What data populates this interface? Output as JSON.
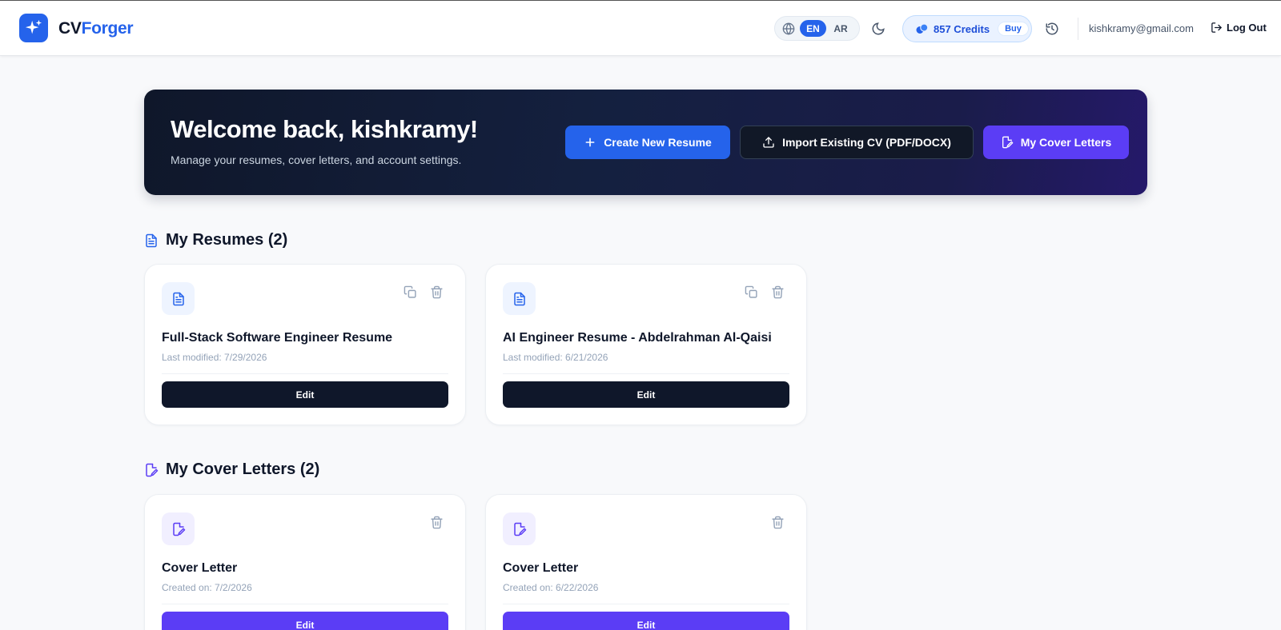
{
  "header": {
    "brand_prefix": "CV",
    "brand_suffix": "Forger",
    "lang_en": "EN",
    "lang_ar": "AR",
    "credits_label": "857 Credits",
    "buy_label": "Buy",
    "email": "kishkramy@gmail.com",
    "logout_label": "Log Out"
  },
  "hero": {
    "title": "Welcome back, kishkramy!",
    "subtitle": "Manage your resumes, cover letters, and account settings.",
    "create_label": "Create New Resume",
    "import_label": "Import Existing CV (PDF/DOCX)",
    "cover_label": "My Cover Letters"
  },
  "resumes": {
    "section_title": "My Resumes (2)",
    "items": [
      {
        "title": "Full-Stack Software Engineer Resume",
        "meta": "Last modified: 7/29/2026",
        "edit": "Edit"
      },
      {
        "title": "AI Engineer Resume - Abdelrahman Al-Qaisi",
        "meta": "Last modified: 6/21/2026",
        "edit": "Edit"
      }
    ]
  },
  "cover_letters": {
    "section_title": "My Cover Letters (2)",
    "items": [
      {
        "title": "Cover Letter",
        "meta": "Created on: 7/2/2026",
        "edit": "Edit"
      },
      {
        "title": "Cover Letter",
        "meta": "Created on: 6/22/2026",
        "edit": "Edit"
      }
    ]
  },
  "colors": {
    "brand": "#2563eb",
    "hero_bg": "#0f172a",
    "cover_accent": "#5b3df5",
    "page_bg": "#f8f9fb"
  },
  "icons": {
    "logo": "sparkle-icon",
    "language": "globe-icon",
    "theme": "moon-icon",
    "credits": "coins-icon",
    "history": "history-icon",
    "logout": "logout-icon",
    "create": "plus-icon",
    "import": "upload-icon",
    "cover": "edit-document-icon",
    "resume": "document-icon",
    "duplicate": "copy-icon",
    "delete": "trash-icon"
  }
}
